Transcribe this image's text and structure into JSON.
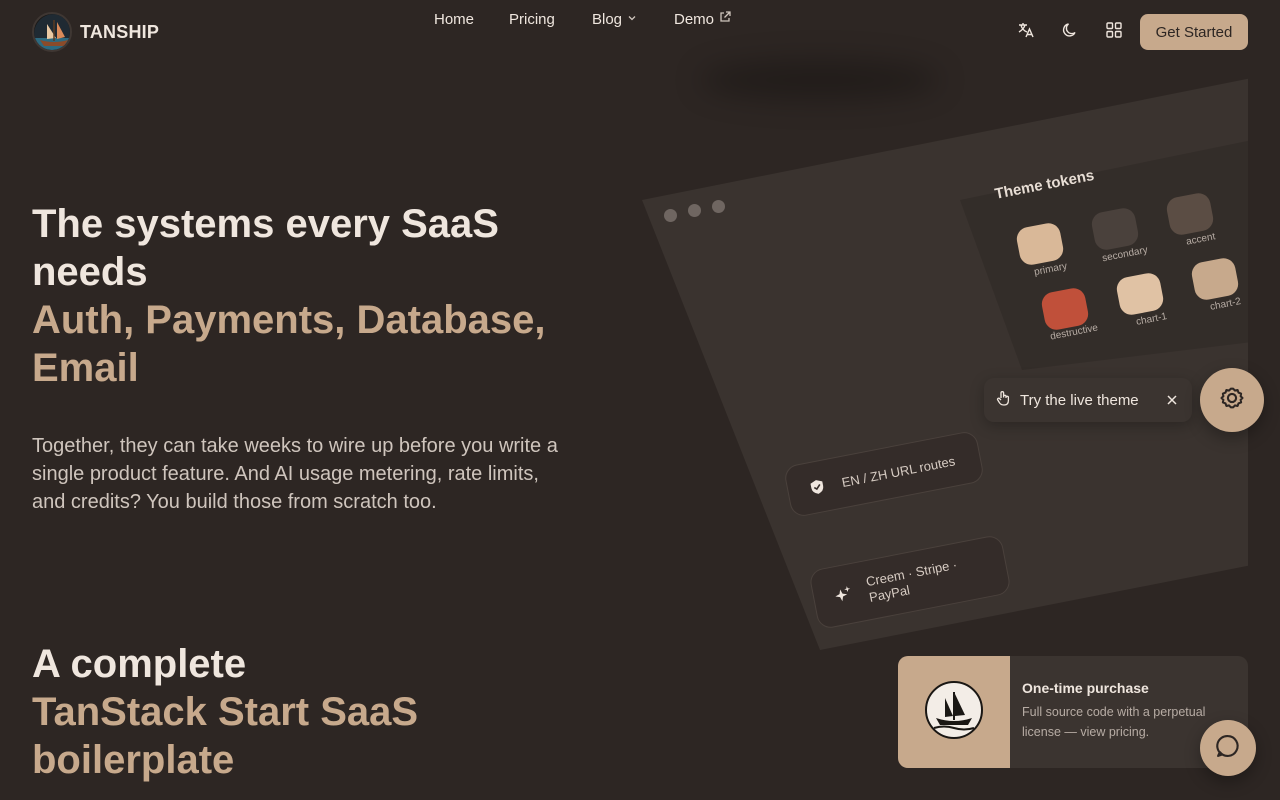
{
  "brand": {
    "name": "TANSHIP",
    "logo_icon": "ship-logo-icon"
  },
  "nav": {
    "home": "Home",
    "pricing": "Pricing",
    "blog": "Blog",
    "demo": "Demo"
  },
  "toolbar": {
    "language_icon": "translate-icon",
    "theme_icon": "moon-icon",
    "apps_icon": "grid-icon",
    "cta_label": "Get Started"
  },
  "hero": {
    "title_line1": "The systems every SaaS needs",
    "title_line2": "Auth, Payments, Database, Email",
    "description": "Together, they can take weeks to wire up before you write a single product feature. And AI usage metering, rate limits, and credits? You build those from scratch too."
  },
  "section": {
    "title_line1": "A complete",
    "title_line2": "TanStack Start SaaS boilerplate"
  },
  "mockup": {
    "tokens_title": "Theme tokens",
    "tokens": [
      {
        "label": "primary",
        "color": "#d9b898"
      },
      {
        "label": "secondary",
        "color": "#4a413c"
      },
      {
        "label": "accent",
        "color": "#5b4d44"
      },
      {
        "label": "destructive",
        "color": "#c0503a"
      },
      {
        "label": "chart-1",
        "color": "#e0c2a4"
      },
      {
        "label": "chart-2",
        "color": "#c7a98c"
      }
    ],
    "feature_routes": "EN / ZH URL routes",
    "feature_payments": "Creem · Stripe · PayPal"
  },
  "live_theme": {
    "label": "Try the live theme"
  },
  "purchase": {
    "title": "One-time purchase",
    "description": "Full source code with a perpetual license — view pricing."
  },
  "colors": {
    "background": "#2d2623",
    "accent": "#c7a98c",
    "text": "#efe6de"
  }
}
